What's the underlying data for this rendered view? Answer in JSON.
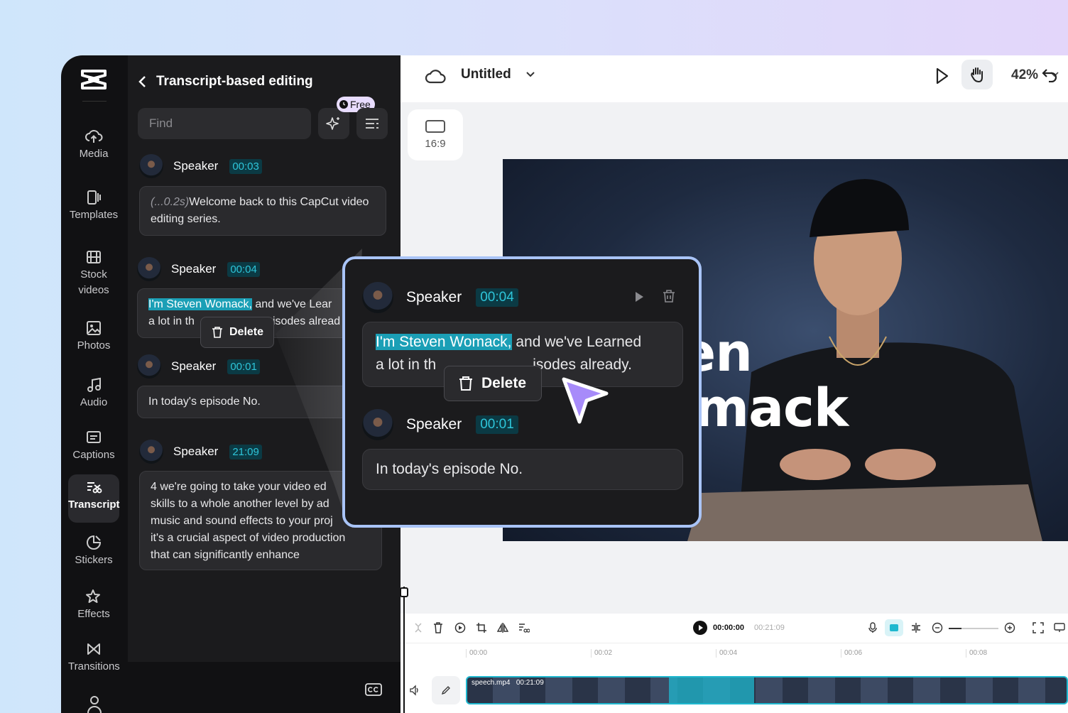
{
  "sidebar": {
    "items": [
      {
        "label": "Media",
        "icon": "cloud-upload-icon"
      },
      {
        "label": "Templates",
        "icon": "templates-icon"
      },
      {
        "label": "Stock",
        "label2": "videos",
        "icon": "film-icon"
      },
      {
        "label": "Photos",
        "icon": "photo-icon"
      },
      {
        "label": "Audio",
        "icon": "music-note-icon"
      },
      {
        "label": "Captions",
        "icon": "captions-icon"
      },
      {
        "label": "Transcript",
        "icon": "transcript-icon",
        "active": true
      },
      {
        "label": "Stickers",
        "icon": "sticker-icon"
      },
      {
        "label": "Effects",
        "icon": "sparkle-star-icon"
      },
      {
        "label": "Transitions",
        "icon": "transition-icon"
      }
    ]
  },
  "panel": {
    "title": "Transcript-based editing",
    "find_placeholder": "Find",
    "free_badge": "Free",
    "entries": [
      {
        "speaker": "Speaker",
        "time": "00:03",
        "pause": "(...0.2s)",
        "text": "Welcome back to this CapCut video editing series."
      },
      {
        "speaker": "Speaker",
        "time": "00:04",
        "highlight": "I'm Steven Womack,",
        "text_line1": " and we've Lear",
        "text_line2a": "a lot in th",
        "text_line2b": "isodes alread"
      },
      {
        "speaker": "Speaker",
        "time": "00:01",
        "text": "In today's episode No."
      },
      {
        "speaker": "Speaker",
        "time": "21:09",
        "lines": [
          "4 we're going to take your video ed",
          "skills to a whole another level by ad",
          "music and sound effects to your proj",
          "it's a crucial aspect of video production",
          "that can significantly enhance"
        ]
      }
    ],
    "delete_label": "Delete"
  },
  "zoom_card": {
    "entry1": {
      "speaker": "Speaker",
      "time": "00:04",
      "highlight": "I'm Steven Womack,",
      "line1_rest": " and we've Learned",
      "line2a": "a lot in th",
      "line2b": "isodes already."
    },
    "entry2": {
      "speaker": "Speaker",
      "time": "00:01",
      "text": "In today's episode No."
    },
    "delete_label": "Delete"
  },
  "topbar": {
    "title": "Untitled",
    "zoom": "42%"
  },
  "canvas": {
    "ratio_label": "16:9",
    "video_text_line1": "en",
    "video_text_line2": "mack"
  },
  "timeline": {
    "current_time": "00:00:00",
    "total_time": "00:21:09",
    "ruler": [
      "00:00",
      "00:02",
      "00:04",
      "00:06",
      "00:08"
    ],
    "clip_name": "speech.mp4",
    "clip_duration": "00:21:09"
  },
  "colors": {
    "accent": "#1fb8cf",
    "highlight": "#1b9fb6",
    "card_border": "#a9c4f7",
    "cursor": "#a78bfa"
  }
}
